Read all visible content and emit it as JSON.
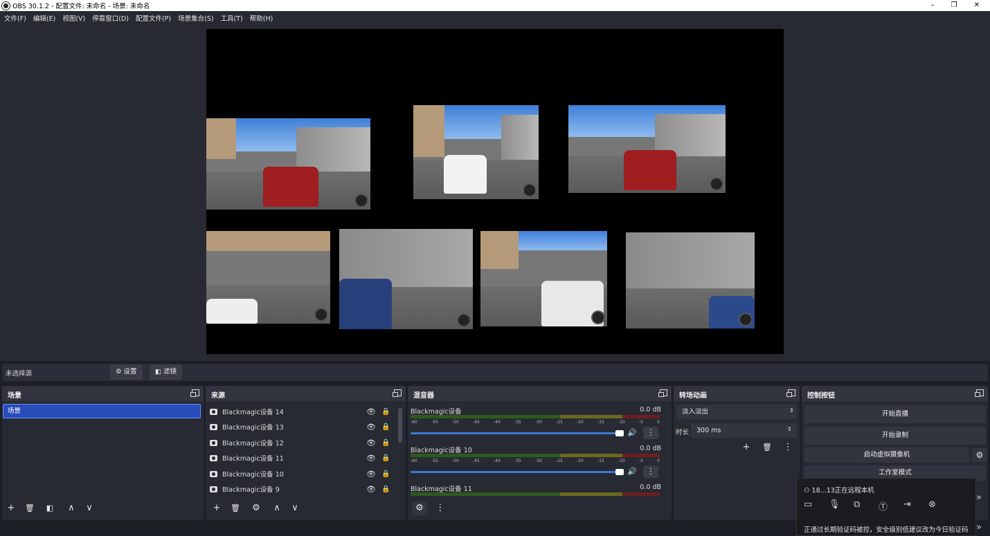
{
  "titlebar": {
    "title": "OBS 30.1.2 - 配置文件: 未命名 - 场景: 未命名",
    "min": "–",
    "restore": "❐",
    "close": "✕"
  },
  "menu": [
    "文件(F)",
    "编辑(E)",
    "视图(V)",
    "停靠窗口(D)",
    "配置文件(P)",
    "场景集合(S)",
    "工具(T)",
    "帮助(H)"
  ],
  "source_toolbar": {
    "label": "未选择源",
    "settings": "⚙ 设置",
    "filters": "◧ 滤镜"
  },
  "scenes": {
    "title": "场景",
    "items": [
      "场景"
    ]
  },
  "sources": {
    "title": "来源",
    "items": [
      "Blackmagic设备 14",
      "Blackmagic设备 13",
      "Blackmagic设备 12",
      "Blackmagic设备 11",
      "Blackmagic设备 10",
      "Blackmagic设备 9"
    ]
  },
  "mixer": {
    "title": "混音器",
    "ticks": [
      "-60",
      "-55",
      "-50",
      "-45",
      "-40",
      "-35",
      "-30",
      "-25",
      "-20",
      "-15",
      "-10",
      "-5",
      "0"
    ],
    "channels": [
      {
        "name": "Blackmagic设备",
        "db": "0.0 dB"
      },
      {
        "name": "Blackmagic设备 10",
        "db": "0.0 dB"
      },
      {
        "name": "Blackmagic设备 11",
        "db": "0.0 dB"
      }
    ]
  },
  "transitions": {
    "title": "转场动画",
    "type": "淡入淡出",
    "duration_label": "时长",
    "duration": "300 ms"
  },
  "controls": {
    "title": "控制按钮",
    "buttons": [
      "开始直播",
      "开始录制",
      "启动虚拟摄像机",
      "工作室模式"
    ]
  },
  "remote": {
    "status": "18...13正在远程本机",
    "notice": "正通过长期验证码被控，安全级别低建议改为今日验证码"
  },
  "icons": {
    "plus": "+",
    "trash": "🗑",
    "gear": "⚙",
    "up": "∧",
    "down": "∨",
    "eye": "👁",
    "lock": "🔒",
    "speaker": "🔊",
    "more": "⋮",
    "expand": "»"
  }
}
